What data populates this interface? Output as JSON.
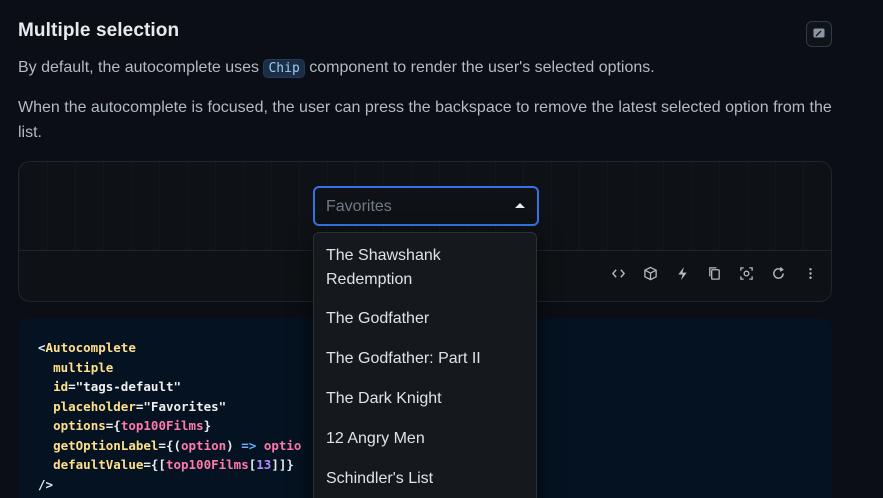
{
  "section": {
    "title": "Multiple selection",
    "para1_before": "By default, the autocomplete uses ",
    "para1_code": "Chip",
    "para1_after": " component to render the user's selected options.",
    "para2": "When the autocomplete is focused, the user can press the backspace to remove the latest selected option from the list."
  },
  "demo": {
    "placeholder": "Favorites",
    "toolbar_icons": [
      "code-icon",
      "codesandbox-icon",
      "stackblitz-icon",
      "copy-icon",
      "reset-focus-icon",
      "reset-icon",
      "more-icon"
    ]
  },
  "dropdown": {
    "options": [
      "The Shawshank Redemption",
      "The Godfather",
      "The Godfather: Part II",
      "The Dark Knight",
      "12 Angry Men",
      "Schindler's List"
    ]
  },
  "code": {
    "l1_open": "<",
    "l1_name": "Autocomplete",
    "l2": "multiple",
    "l3_attr": "id",
    "l3_str": "\"tags-default\"",
    "l4_attr": "placeholder",
    "l4_str": "\"Favorites\"",
    "l5_attr": "options",
    "l5_id": "top100Films",
    "l6_attr": "getOptionLabel",
    "l6_param": "option",
    "l6_rest": "optio",
    "l7_attr": "defaultValue",
    "l7_id": "top100Films",
    "l7_num": "13",
    "l8": "/>"
  },
  "colors": {
    "accent": "#3373e6",
    "background": "#0b0e14",
    "code_background": "#051221"
  }
}
